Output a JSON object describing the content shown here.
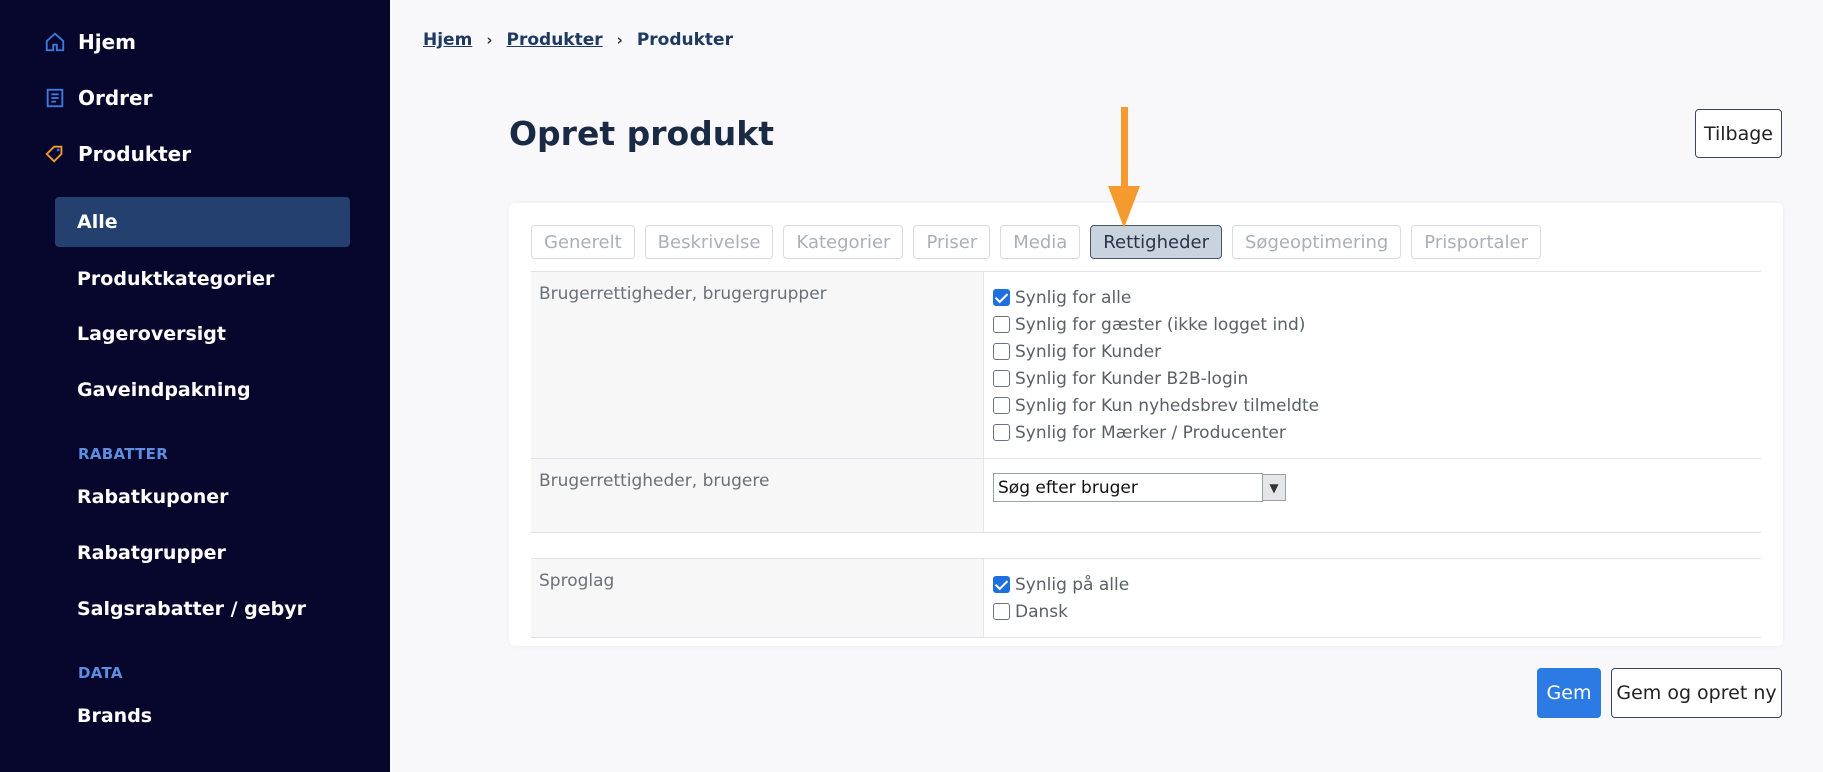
{
  "sidebar": {
    "top_items": [
      {
        "label": "Hjem",
        "icon": "home-icon"
      },
      {
        "label": "Ordrer",
        "icon": "orders-icon"
      },
      {
        "label": "Produkter",
        "icon": "tag-icon"
      }
    ],
    "sub_items": [
      {
        "label": "Alle",
        "active": true
      },
      {
        "label": "Produktkategorier"
      },
      {
        "label": "Lageroversigt"
      },
      {
        "label": "Gaveindpakning"
      }
    ],
    "sections": [
      {
        "title": "RABATTER",
        "items": [
          "Rabatkuponer",
          "Rabatgrupper",
          "Salgsrabatter / gebyr"
        ]
      },
      {
        "title": "DATA",
        "items": [
          "Brands"
        ]
      }
    ],
    "colors": {
      "background": "#07072e",
      "active": "#24406e",
      "section": "#5e8ee0"
    }
  },
  "breadcrumb": [
    "Hjem",
    "Produkter",
    "Produkter"
  ],
  "page_title": "Opret produkt",
  "back_label": "Tilbage",
  "tabs": [
    "Generelt",
    "Beskrivelse",
    "Kategorier",
    "Priser",
    "Media",
    "Rettigheder",
    "Søgeoptimering",
    "Prisportaler"
  ],
  "active_tab": "Rettigheder",
  "rows": {
    "groups": {
      "label": "Brugerrettigheder, brugergrupper",
      "options": [
        {
          "label": "Synlig for alle",
          "checked": true
        },
        {
          "label": "Synlig for gæster (ikke logget ind)",
          "checked": false
        },
        {
          "label": "Synlig for Kunder",
          "checked": false
        },
        {
          "label": "Synlig for Kunder B2B-login",
          "checked": false
        },
        {
          "label": "Synlig for Kun nyhedsbrev tilmeldte",
          "checked": false
        },
        {
          "label": "Synlig for Mærker / Producenter",
          "checked": false
        }
      ]
    },
    "users": {
      "label": "Brugerrettigheder, brugere",
      "select_value": "Søg efter bruger"
    },
    "language": {
      "label": "Sproglag",
      "options": [
        {
          "label": "Synlig på alle",
          "checked": true
        },
        {
          "label": "Dansk",
          "checked": false
        }
      ]
    }
  },
  "actions": {
    "save": "Gem",
    "save_new": "Gem og opret ny"
  },
  "colors": {
    "primary": "#2c7be5",
    "annotation_arrow": "#f59a2f"
  }
}
